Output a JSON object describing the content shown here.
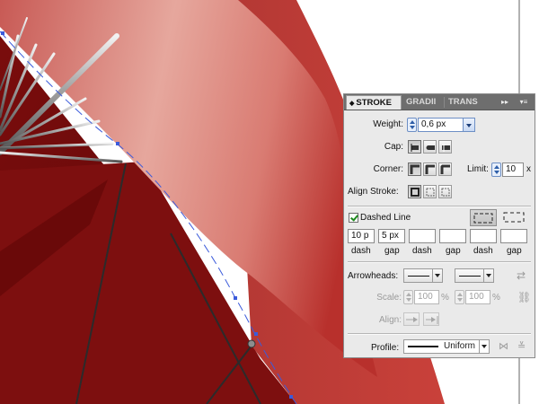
{
  "canvas": {
    "colors": {
      "background": "#ffffff",
      "umbrella_dark": "#6f0b0b",
      "umbrella_mid": "#9a1717",
      "umbrella_light": "#e9a8a0",
      "path_selection": "#3b5bdb"
    }
  },
  "stroke_panel": {
    "tabs": [
      {
        "label": "STROKE",
        "active": true
      },
      {
        "label": "GRADII",
        "active": false
      },
      {
        "label": "TRANS",
        "active": false
      }
    ],
    "weight": {
      "label": "Weight:",
      "value": "0,6 px"
    },
    "cap": {
      "label": "Cap:",
      "options": [
        "butt-cap-icon",
        "round-cap-icon",
        "projecting-cap-icon"
      ],
      "selected": 0
    },
    "corner": {
      "label": "Corner:",
      "options": [
        "miter-join-icon",
        "round-join-icon",
        "bevel-join-icon"
      ],
      "selected": 0
    },
    "limit": {
      "label": "Limit:",
      "value": "10",
      "unit": "x"
    },
    "align_stroke": {
      "label": "Align Stroke:",
      "options": [
        "align-center-icon",
        "align-inside-icon",
        "align-outside-icon"
      ],
      "selected": 0
    },
    "dashed_line": {
      "label": "Dashed Line",
      "checked": true
    },
    "dash_gap": [
      {
        "value": "10 p",
        "label": "dash"
      },
      {
        "value": "5 px",
        "label": "gap"
      },
      {
        "value": "",
        "label": "dash"
      },
      {
        "value": "",
        "label": "gap"
      },
      {
        "value": "",
        "label": "dash"
      },
      {
        "value": "",
        "label": "gap"
      }
    ],
    "arrowheads": {
      "label": "Arrowheads:"
    },
    "scale": {
      "label": "Scale:",
      "start": "100",
      "end": "100",
      "unit": "%"
    },
    "align": {
      "label": "Align:"
    },
    "profile": {
      "label": "Profile:",
      "value": "Uniform"
    }
  }
}
